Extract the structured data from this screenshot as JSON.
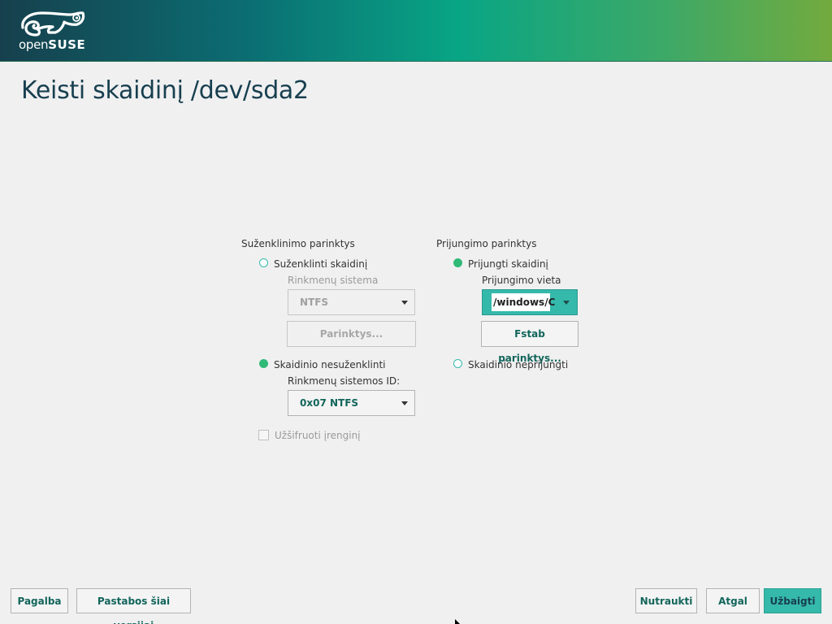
{
  "header": {
    "logo_text_light": "open",
    "logo_text_bold": "SUSE",
    "colors": {
      "banner_start": "#16404d",
      "banner_mid": "#08a585",
      "banner_end": "#73aa3e"
    }
  },
  "page": {
    "title": "Keisti skaidinį /dev/sda2"
  },
  "format_options": {
    "title": "Suženklinimo parinktys",
    "format_radio_label": "Suženklinti skaidinį",
    "format_selected": false,
    "filesystem_label": "Rinkmenų sistema",
    "filesystem_value": "NTFS",
    "options_button": "Parinktys...",
    "noformat_radio_label": "Skaidinio nesuženklinti",
    "noformat_selected": true,
    "fsid_label": "Rinkmenų sistemos ID:",
    "fsid_value": "0x07 NTFS",
    "encrypt_label": "Užšifruoti įrenginį",
    "encrypt_checked": false
  },
  "mount_options": {
    "title": "Prijungimo parinktys",
    "mount_radio_label": "Prijungti skaidinį",
    "mount_selected": true,
    "mountpoint_label": "Prijungimo vieta",
    "mountpoint_value": "/windows/C",
    "fstab_button": "Fstab parinktys...",
    "nomount_radio_label": "Skaidinio neprijungti",
    "nomount_selected": false
  },
  "footer": {
    "help": "Pagalba",
    "release_notes": "Pastabos šiai versijai",
    "abort": "Nutraukti",
    "back": "Atgal",
    "finish": "Užbaigti"
  },
  "colors": {
    "accent": "#35b9ab",
    "radio_on": "#30ba78",
    "title": "#173f4f",
    "link_text": "#12655a"
  }
}
